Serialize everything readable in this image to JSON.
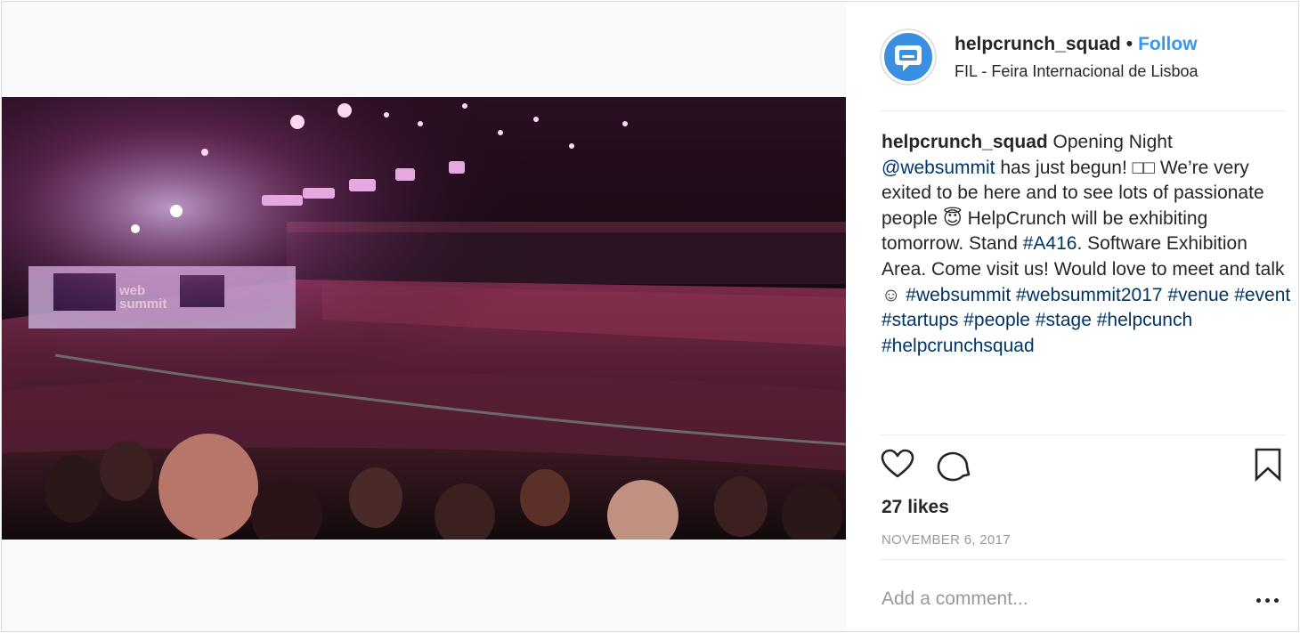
{
  "header": {
    "username": "helpcrunch_squad",
    "separator": "•",
    "follow_label": "Follow",
    "location": "FIL - Feira Internacional de Lisboa",
    "avatar_icon": "chat-bubble-icon"
  },
  "caption": {
    "username": "helpcrunch_squad",
    "part1": " Opening Night ",
    "mention": "@websummit",
    "part2": " has just begun! □□ We’re very exited to be here and to see lots of passionate people 😇 HelpCrunch will be exhibiting tomorrow. Stand ",
    "tag_a416": "#A416",
    "part3": ". Software Exhibition Area. Come visit us! Would love to meet and talk ☺ ",
    "hashtags": [
      "#websummit",
      "#websummit2017",
      "#venue",
      "#event",
      "#startups",
      "#people",
      "#stage",
      "#helpcunch",
      "#helpcrunchsquad"
    ]
  },
  "actions": {
    "like_icon": "heart-icon",
    "comment_icon": "comment-icon",
    "save_icon": "bookmark-icon"
  },
  "likes": "27 likes",
  "date": "NOVEMBER 6, 2017",
  "comment": {
    "placeholder": "Add a comment...",
    "more_icon": "more-options-icon"
  },
  "colors": {
    "follow": "#3897f0",
    "link": "#003569",
    "muted": "#999999",
    "text": "#262626",
    "avatar": "#3b8fe0"
  }
}
